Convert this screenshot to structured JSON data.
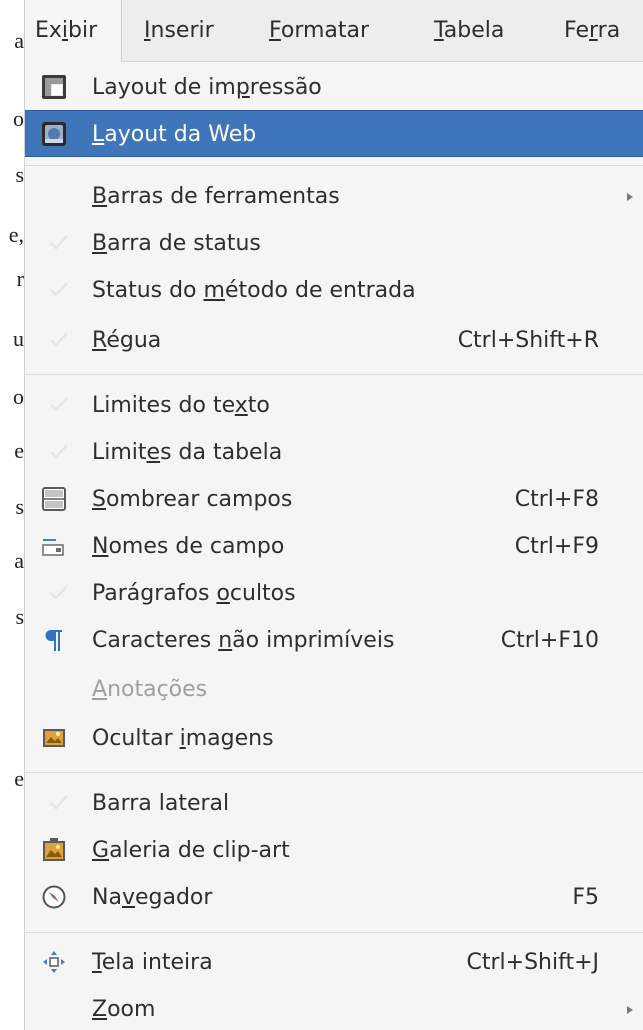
{
  "menubar": {
    "items": [
      {
        "pre": "Ex",
        "mn": "i",
        "post": "bir"
      },
      {
        "pre": "",
        "mn": "I",
        "post": "nserir"
      },
      {
        "pre": "",
        "mn": "F",
        "post": "ormatar"
      },
      {
        "pre": "",
        "mn": "T",
        "post": "abela"
      },
      {
        "pre": "Fe",
        "mn": "r",
        "post": "ra"
      }
    ]
  },
  "doc_chars": [
    "a",
    "o",
    "s",
    "e,",
    "r",
    "u",
    "o",
    "e",
    "s",
    "a",
    "s",
    "e"
  ],
  "menu": {
    "items": [
      {
        "pre": "Layout de im",
        "mn": "p",
        "post": "ressão",
        "shortcut": "",
        "icon": "print-layout-icon"
      },
      {
        "pre": "",
        "mn": "L",
        "post": "ayout da Web",
        "shortcut": "",
        "icon": "web-layout-icon"
      },
      {
        "pre": "",
        "mn": "B",
        "post": "arras de ferramentas",
        "shortcut": "",
        "submenu": true
      },
      {
        "pre": "",
        "mn": "B",
        "post": "arra de status",
        "shortcut": "",
        "check": true
      },
      {
        "pre": "Status do ",
        "mn": "m",
        "post": "étodo de entrada",
        "shortcut": "",
        "check": true
      },
      {
        "pre": "",
        "mn": "R",
        "post": "égua",
        "shortcut": "Ctrl+Shift+R",
        "check": true
      },
      {
        "pre": "Limites do te",
        "mn": "x",
        "post": "to",
        "shortcut": "",
        "check": true
      },
      {
        "pre": "Limit",
        "mn": "e",
        "post": "s da tabela",
        "shortcut": "",
        "check": true
      },
      {
        "pre": "",
        "mn": "S",
        "post": "ombrear campos",
        "shortcut": "Ctrl+F8",
        "icon": "field-shadings-icon"
      },
      {
        "pre": "",
        "mn": "N",
        "post": "omes de campo",
        "shortcut": "Ctrl+F9",
        "icon": "field-names-icon"
      },
      {
        "pre": "Parágrafos ",
        "mn": "o",
        "post": "cultos",
        "shortcut": "",
        "check": true
      },
      {
        "pre": "Caracteres ",
        "mn": "n",
        "post": "ão imprimíveis",
        "shortcut": "Ctrl+F10",
        "icon": "pilcrow-icon"
      },
      {
        "pre": "",
        "mn": "A",
        "post": "notações",
        "shortcut": "",
        "disabled": true
      },
      {
        "pre": "Ocultar ",
        "mn": "i",
        "post": "magens",
        "shortcut": "",
        "icon": "hide-images-icon"
      },
      {
        "pre": "Barra lateral",
        "mn": "",
        "post": "",
        "shortcut": "",
        "check": true
      },
      {
        "pre": "",
        "mn": "G",
        "post": "aleria de clip-art",
        "shortcut": "",
        "icon": "gallery-icon"
      },
      {
        "pre": "Na",
        "mn": "v",
        "post": "egador",
        "shortcut": "F5",
        "icon": "navigator-icon"
      },
      {
        "pre": "",
        "mn": "T",
        "post": "ela inteira",
        "shortcut": "Ctrl+Shift+J",
        "icon": "full-screen-icon"
      },
      {
        "pre": "",
        "mn": "Z",
        "post": "oom",
        "shortcut": "",
        "submenu": true
      }
    ]
  },
  "colors": {
    "highlight": "#3e76b9",
    "menu_bg": "#f5f5f5",
    "text": "#2e2e2e",
    "disabled_text": "#a0a0a0"
  }
}
